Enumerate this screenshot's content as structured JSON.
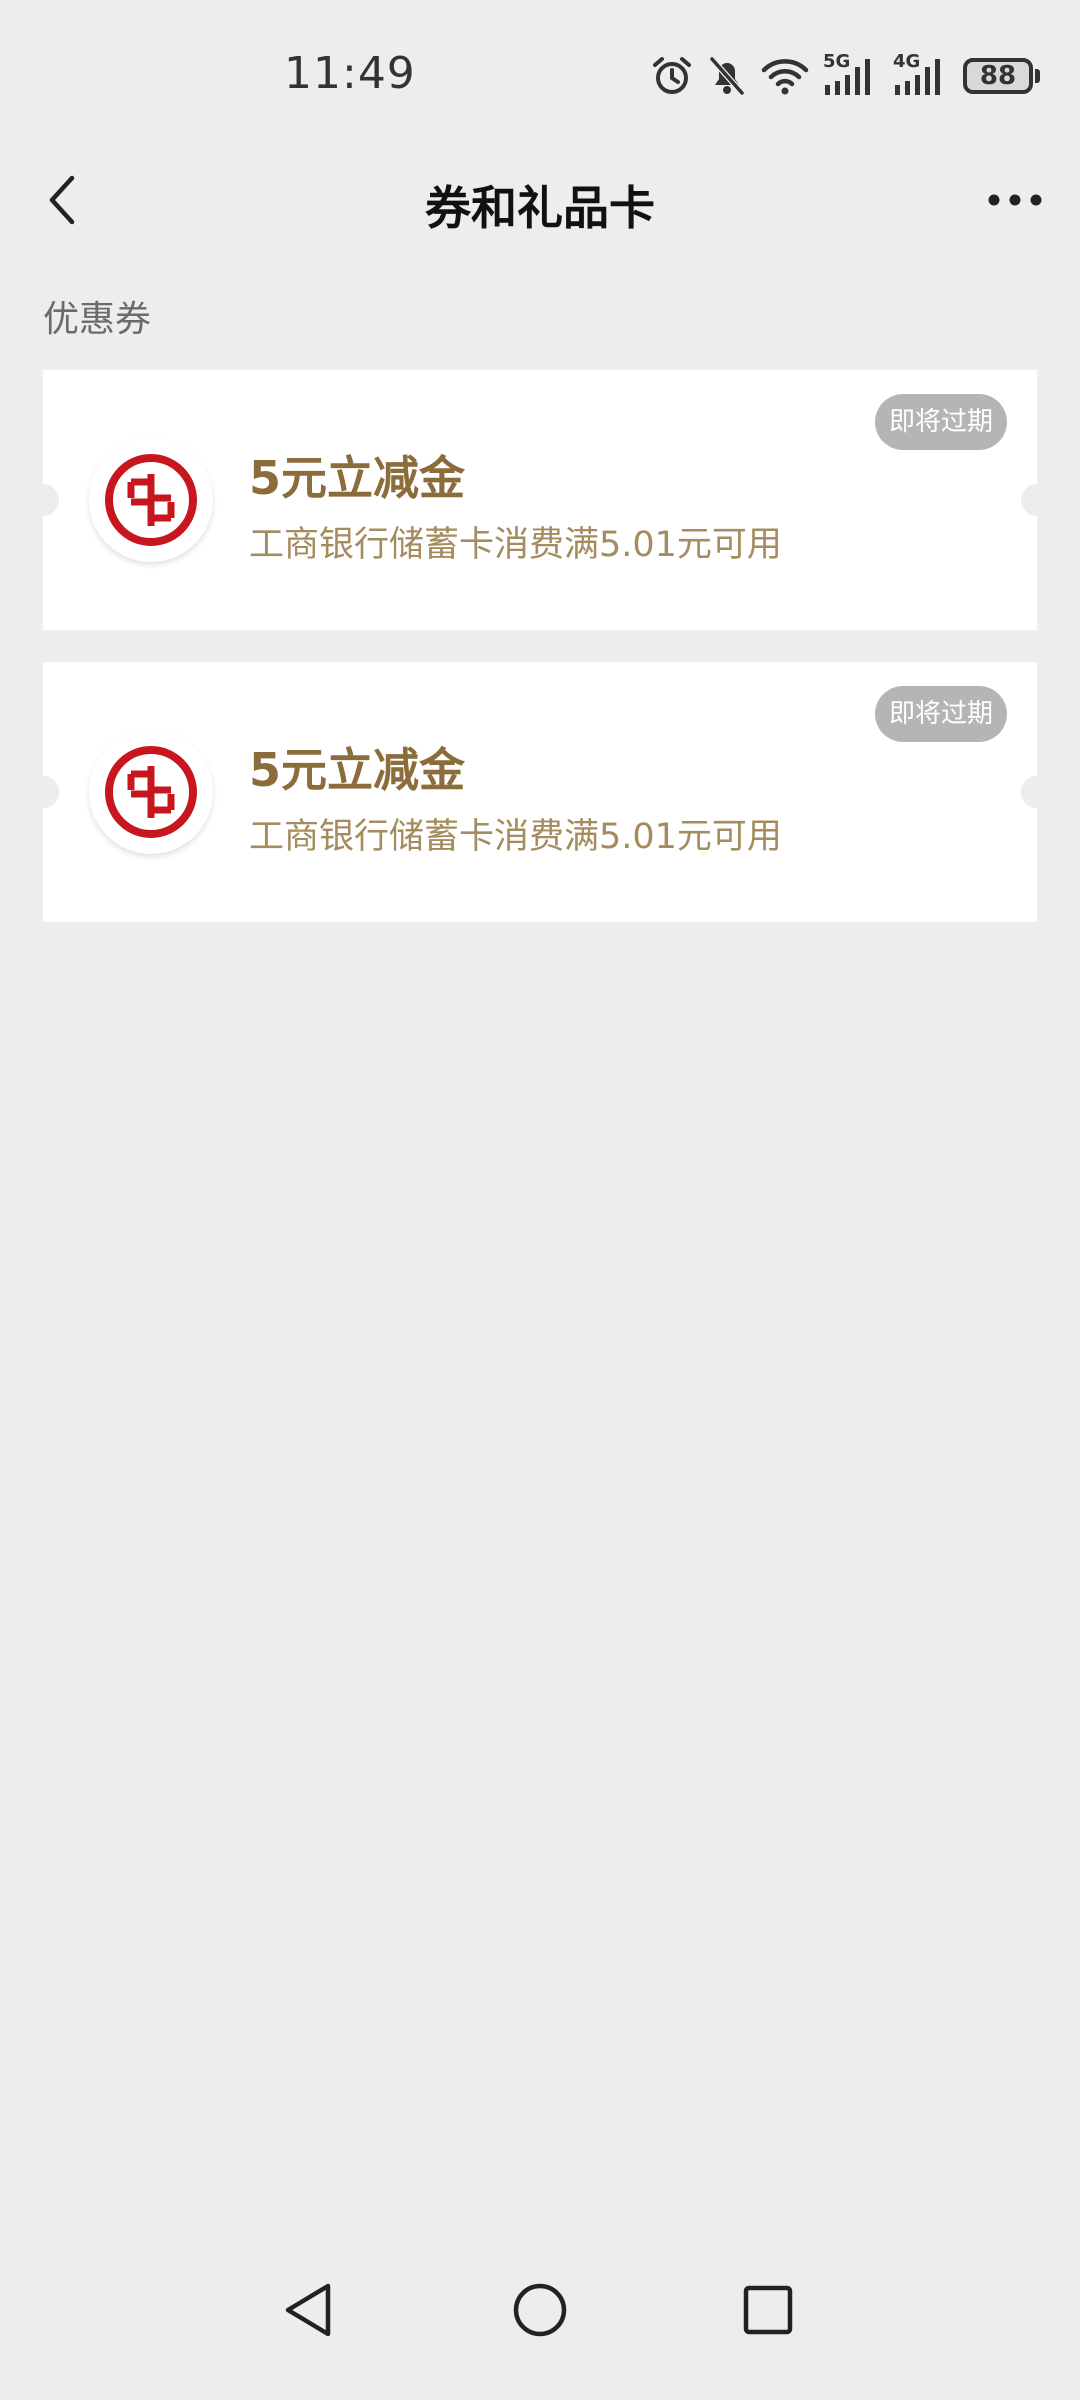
{
  "status_bar": {
    "time": "11:49",
    "network_5g": "5G",
    "network_4g": "4G",
    "battery": "88"
  },
  "nav": {
    "title": "券和礼品卡"
  },
  "section": {
    "label": "优惠券"
  },
  "coupons": [
    {
      "title": "5元立减金",
      "description": "工商银行储蓄卡消费满5.01元可用",
      "badge": "即将过期",
      "logo_icon": "icbc-logo-icon"
    },
    {
      "title": "5元立减金",
      "description": "工商银行储蓄卡消费满5.01元可用",
      "badge": "即将过期",
      "logo_icon": "icbc-logo-icon"
    }
  ],
  "colors": {
    "background": "#ededed",
    "card": "#ffffff",
    "coupon_title": "#8a6d3b",
    "coupon_desc": "#a48c5f",
    "badge": "#b5b5b5",
    "icbc_red": "#c7161d"
  }
}
